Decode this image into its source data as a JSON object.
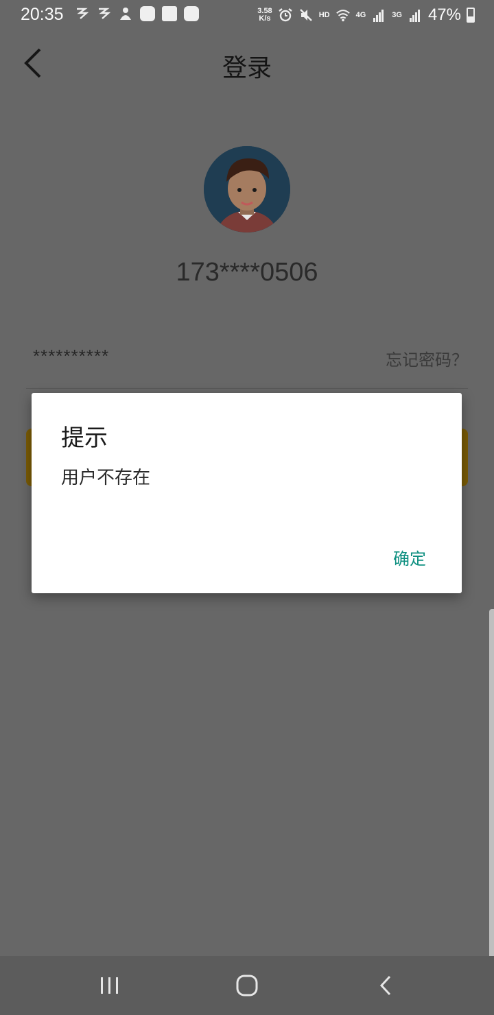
{
  "status_bar": {
    "time": "20:35",
    "speed_value": "3.58",
    "speed_unit": "K/s",
    "hd": "HD",
    "net_4g": "4G",
    "net_3g": "3G",
    "battery": "47%"
  },
  "app_bar": {
    "title": "登录",
    "back_icon": "chevron-left-icon"
  },
  "profile": {
    "phone_masked": "173****0506"
  },
  "password": {
    "masked_value": "**********",
    "forgot_label": "忘记密码？"
  },
  "dialog": {
    "title": "提示",
    "message": "用户不存在",
    "ok_label": "确定"
  },
  "colors": {
    "overlay_bg": "#676767",
    "dialog_bg": "#ffffff",
    "accent_teal": "#0d8f80",
    "login_button": "#7a5b05"
  },
  "nav_bar": {
    "recents_icon": "recents-icon",
    "home_icon": "home-icon",
    "back_icon": "back-icon"
  }
}
